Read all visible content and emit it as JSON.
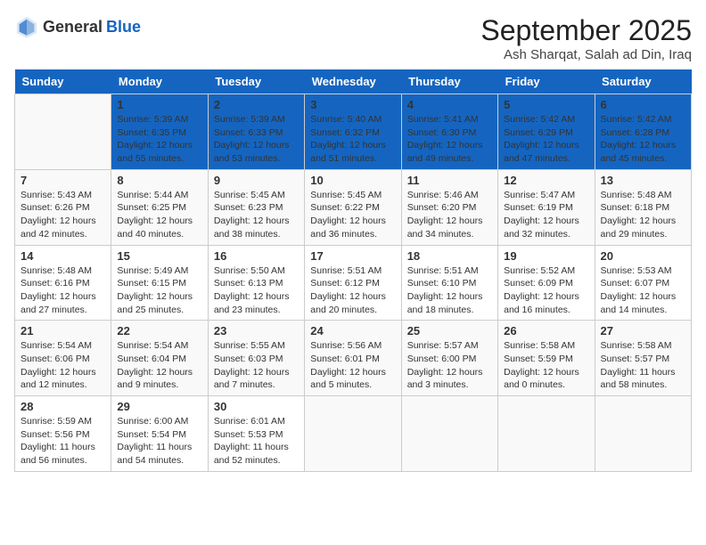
{
  "logo": {
    "general": "General",
    "blue": "Blue"
  },
  "title": "September 2025",
  "location": "Ash Sharqat, Salah ad Din, Iraq",
  "days": [
    "Sunday",
    "Monday",
    "Tuesday",
    "Wednesday",
    "Thursday",
    "Friday",
    "Saturday"
  ],
  "weeks": [
    [
      {
        "date": "",
        "sunrise": "",
        "sunset": "",
        "daylight": ""
      },
      {
        "date": "1",
        "sunrise": "Sunrise: 5:39 AM",
        "sunset": "Sunset: 6:35 PM",
        "daylight": "Daylight: 12 hours and 55 minutes."
      },
      {
        "date": "2",
        "sunrise": "Sunrise: 5:39 AM",
        "sunset": "Sunset: 6:33 PM",
        "daylight": "Daylight: 12 hours and 53 minutes."
      },
      {
        "date": "3",
        "sunrise": "Sunrise: 5:40 AM",
        "sunset": "Sunset: 6:32 PM",
        "daylight": "Daylight: 12 hours and 51 minutes."
      },
      {
        "date": "4",
        "sunrise": "Sunrise: 5:41 AM",
        "sunset": "Sunset: 6:30 PM",
        "daylight": "Daylight: 12 hours and 49 minutes."
      },
      {
        "date": "5",
        "sunrise": "Sunrise: 5:42 AM",
        "sunset": "Sunset: 6:29 PM",
        "daylight": "Daylight: 12 hours and 47 minutes."
      },
      {
        "date": "6",
        "sunrise": "Sunrise: 5:42 AM",
        "sunset": "Sunset: 6:28 PM",
        "daylight": "Daylight: 12 hours and 45 minutes."
      }
    ],
    [
      {
        "date": "7",
        "sunrise": "Sunrise: 5:43 AM",
        "sunset": "Sunset: 6:26 PM",
        "daylight": "Daylight: 12 hours and 42 minutes."
      },
      {
        "date": "8",
        "sunrise": "Sunrise: 5:44 AM",
        "sunset": "Sunset: 6:25 PM",
        "daylight": "Daylight: 12 hours and 40 minutes."
      },
      {
        "date": "9",
        "sunrise": "Sunrise: 5:45 AM",
        "sunset": "Sunset: 6:23 PM",
        "daylight": "Daylight: 12 hours and 38 minutes."
      },
      {
        "date": "10",
        "sunrise": "Sunrise: 5:45 AM",
        "sunset": "Sunset: 6:22 PM",
        "daylight": "Daylight: 12 hours and 36 minutes."
      },
      {
        "date": "11",
        "sunrise": "Sunrise: 5:46 AM",
        "sunset": "Sunset: 6:20 PM",
        "daylight": "Daylight: 12 hours and 34 minutes."
      },
      {
        "date": "12",
        "sunrise": "Sunrise: 5:47 AM",
        "sunset": "Sunset: 6:19 PM",
        "daylight": "Daylight: 12 hours and 32 minutes."
      },
      {
        "date": "13",
        "sunrise": "Sunrise: 5:48 AM",
        "sunset": "Sunset: 6:18 PM",
        "daylight": "Daylight: 12 hours and 29 minutes."
      }
    ],
    [
      {
        "date": "14",
        "sunrise": "Sunrise: 5:48 AM",
        "sunset": "Sunset: 6:16 PM",
        "daylight": "Daylight: 12 hours and 27 minutes."
      },
      {
        "date": "15",
        "sunrise": "Sunrise: 5:49 AM",
        "sunset": "Sunset: 6:15 PM",
        "daylight": "Daylight: 12 hours and 25 minutes."
      },
      {
        "date": "16",
        "sunrise": "Sunrise: 5:50 AM",
        "sunset": "Sunset: 6:13 PM",
        "daylight": "Daylight: 12 hours and 23 minutes."
      },
      {
        "date": "17",
        "sunrise": "Sunrise: 5:51 AM",
        "sunset": "Sunset: 6:12 PM",
        "daylight": "Daylight: 12 hours and 20 minutes."
      },
      {
        "date": "18",
        "sunrise": "Sunrise: 5:51 AM",
        "sunset": "Sunset: 6:10 PM",
        "daylight": "Daylight: 12 hours and 18 minutes."
      },
      {
        "date": "19",
        "sunrise": "Sunrise: 5:52 AM",
        "sunset": "Sunset: 6:09 PM",
        "daylight": "Daylight: 12 hours and 16 minutes."
      },
      {
        "date": "20",
        "sunrise": "Sunrise: 5:53 AM",
        "sunset": "Sunset: 6:07 PM",
        "daylight": "Daylight: 12 hours and 14 minutes."
      }
    ],
    [
      {
        "date": "21",
        "sunrise": "Sunrise: 5:54 AM",
        "sunset": "Sunset: 6:06 PM",
        "daylight": "Daylight: 12 hours and 12 minutes."
      },
      {
        "date": "22",
        "sunrise": "Sunrise: 5:54 AM",
        "sunset": "Sunset: 6:04 PM",
        "daylight": "Daylight: 12 hours and 9 minutes."
      },
      {
        "date": "23",
        "sunrise": "Sunrise: 5:55 AM",
        "sunset": "Sunset: 6:03 PM",
        "daylight": "Daylight: 12 hours and 7 minutes."
      },
      {
        "date": "24",
        "sunrise": "Sunrise: 5:56 AM",
        "sunset": "Sunset: 6:01 PM",
        "daylight": "Daylight: 12 hours and 5 minutes."
      },
      {
        "date": "25",
        "sunrise": "Sunrise: 5:57 AM",
        "sunset": "Sunset: 6:00 PM",
        "daylight": "Daylight: 12 hours and 3 minutes."
      },
      {
        "date": "26",
        "sunrise": "Sunrise: 5:58 AM",
        "sunset": "Sunset: 5:59 PM",
        "daylight": "Daylight: 12 hours and 0 minutes."
      },
      {
        "date": "27",
        "sunrise": "Sunrise: 5:58 AM",
        "sunset": "Sunset: 5:57 PM",
        "daylight": "Daylight: 11 hours and 58 minutes."
      }
    ],
    [
      {
        "date": "28",
        "sunrise": "Sunrise: 5:59 AM",
        "sunset": "Sunset: 5:56 PM",
        "daylight": "Daylight: 11 hours and 56 minutes."
      },
      {
        "date": "29",
        "sunrise": "Sunrise: 6:00 AM",
        "sunset": "Sunset: 5:54 PM",
        "daylight": "Daylight: 11 hours and 54 minutes."
      },
      {
        "date": "30",
        "sunrise": "Sunrise: 6:01 AM",
        "sunset": "Sunset: 5:53 PM",
        "daylight": "Daylight: 11 hours and 52 minutes."
      },
      {
        "date": "",
        "sunrise": "",
        "sunset": "",
        "daylight": ""
      },
      {
        "date": "",
        "sunrise": "",
        "sunset": "",
        "daylight": ""
      },
      {
        "date": "",
        "sunrise": "",
        "sunset": "",
        "daylight": ""
      },
      {
        "date": "",
        "sunrise": "",
        "sunset": "",
        "daylight": ""
      }
    ]
  ]
}
